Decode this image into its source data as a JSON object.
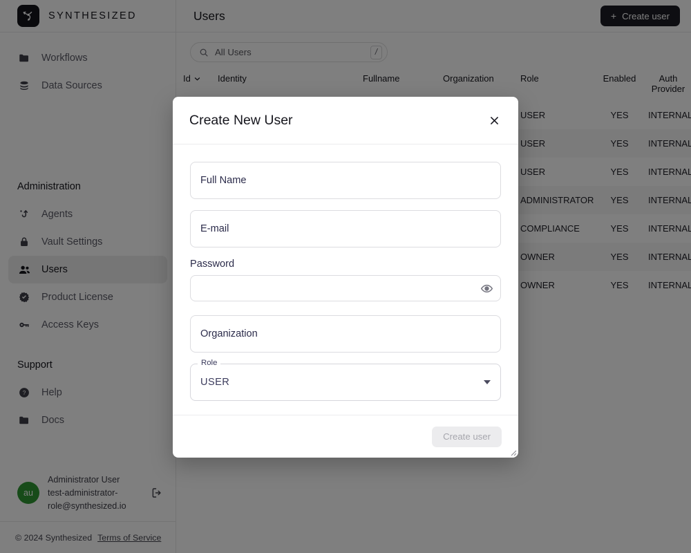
{
  "brand": {
    "name": "SYNTHESIZED",
    "logo_icon": "synthesized-logo-icon"
  },
  "sidebar": {
    "primary_items": [
      {
        "label": "Workflows",
        "icon": "folder-icon"
      },
      {
        "label": "Data Sources",
        "icon": "database-icon"
      }
    ],
    "admin_heading": "Administration",
    "admin_items": [
      {
        "label": "Agents",
        "icon": "agents-icon",
        "active": false
      },
      {
        "label": "Vault Settings",
        "icon": "lock-icon",
        "active": false
      },
      {
        "label": "Users",
        "icon": "users-icon",
        "active": true
      },
      {
        "label": "Product License",
        "icon": "badge-check-icon",
        "active": false
      },
      {
        "label": "Access Keys",
        "icon": "key-icon",
        "active": false
      }
    ],
    "support_heading": "Support",
    "support_items": [
      {
        "label": "Help",
        "icon": "question-circle-icon"
      },
      {
        "label": "Docs",
        "icon": "folder-icon"
      }
    ],
    "user": {
      "initials": "au",
      "name": "Administrator User",
      "email_line1": "test-administrator-",
      "email_line2": "role@synthesized.io",
      "logout_icon": "logout-icon",
      "avatar_color": "#2e9632"
    },
    "footer": {
      "copyright": "© 2024 Synthesized",
      "terms_link": "Terms of Service"
    }
  },
  "topbar": {
    "title": "Users",
    "create_button": {
      "label": "Create user",
      "icon": "plus-icon"
    }
  },
  "search": {
    "icon": "search-icon",
    "value": "All Users",
    "shortcut": "/"
  },
  "table": {
    "columns": [
      "Id",
      "Identity",
      "Fullname",
      "Organization",
      "Role",
      "Enabled",
      "Auth Provider"
    ],
    "sort_icon": "chevron-down-icon",
    "rows": [
      {
        "id": "",
        "identity": "",
        "fullname": "",
        "organization": "",
        "role": "USER",
        "enabled": "YES",
        "auth_provider": "INTERNAL"
      },
      {
        "id": "",
        "identity": "",
        "fullname": "",
        "organization": "",
        "role": "USER",
        "enabled": "YES",
        "auth_provider": "INTERNAL"
      },
      {
        "id": "",
        "identity": "",
        "fullname": "",
        "organization": "",
        "role": "USER",
        "enabled": "YES",
        "auth_provider": "INTERNAL"
      },
      {
        "id": "",
        "identity": "",
        "fullname": "",
        "organization": "",
        "role": "ADMINISTRATOR",
        "enabled": "YES",
        "auth_provider": "INTERNAL"
      },
      {
        "id": "",
        "identity": "",
        "fullname": "",
        "organization": "",
        "role": "COMPLIANCE",
        "enabled": "YES",
        "auth_provider": "INTERNAL"
      },
      {
        "id": "",
        "identity": "",
        "fullname": "",
        "organization": "",
        "role": "OWNER",
        "enabled": "YES",
        "auth_provider": "INTERNAL"
      },
      {
        "id": "",
        "identity": "",
        "fullname": "",
        "organization": "",
        "role": "OWNER",
        "enabled": "YES",
        "auth_provider": "INTERNAL"
      }
    ]
  },
  "modal": {
    "title": "Create New User",
    "close_icon": "close-icon",
    "fields": {
      "fullname": {
        "placeholder": "Full Name",
        "value": ""
      },
      "email": {
        "placeholder": "E-mail",
        "value": ""
      },
      "password": {
        "label": "Password",
        "value": "",
        "toggle_icon": "eye-icon"
      },
      "organization": {
        "placeholder": "Organization",
        "value": ""
      },
      "role": {
        "label": "Role",
        "value": "USER",
        "dropdown_icon": "triangle-down-icon"
      }
    },
    "submit": {
      "label": "Create user",
      "disabled": true
    },
    "resize_handle": "resize-grip-icon"
  },
  "colors": {
    "accent_dark": "#1c1c24",
    "avatar_green": "#2e9632",
    "field_text": "#2b2b4a",
    "scrim": "rgba(0,0,0,0.5)"
  }
}
